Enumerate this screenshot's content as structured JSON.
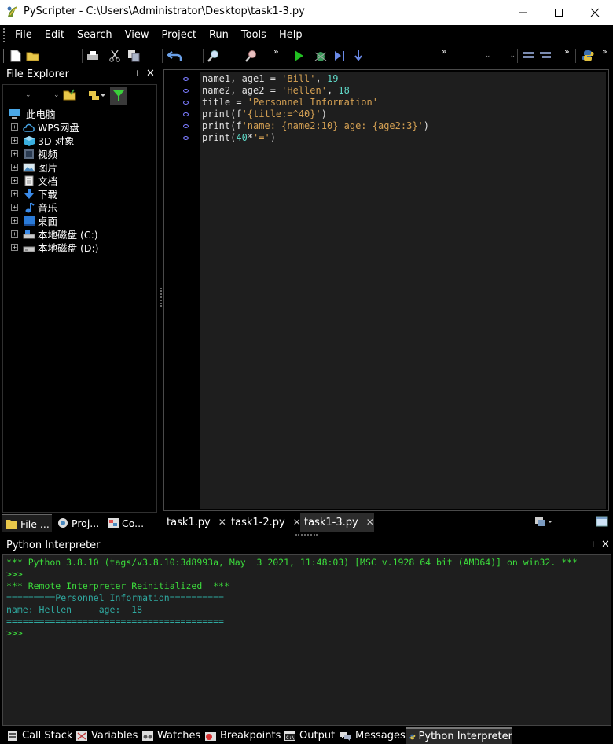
{
  "window": {
    "title": "PyScripter - C:\\Users\\Administrator\\Desktop\\task1-3.py"
  },
  "menu": [
    "File",
    "Edit",
    "Search",
    "View",
    "Project",
    "Run",
    "Tools",
    "Help"
  ],
  "file_explorer": {
    "title": "File Explorer",
    "root": "此电脑",
    "items": [
      "WPS网盘",
      "3D 对象",
      "视频",
      "图片",
      "文档",
      "下载",
      "音乐",
      "桌面",
      "本地磁盘 (C:)",
      "本地磁盘 (D:)"
    ],
    "tabs": [
      "File ...",
      "Proj...",
      "Co..."
    ]
  },
  "editor": {
    "lines": [
      [
        {
          "t": "name1, age1 = ",
          "c": ""
        },
        {
          "t": "'Bill'",
          "c": "s"
        },
        {
          "t": ", ",
          "c": ""
        },
        {
          "t": "19",
          "c": "n"
        }
      ],
      [
        {
          "t": "name2, age2 = ",
          "c": ""
        },
        {
          "t": "'Hellen'",
          "c": "s"
        },
        {
          "t": ", ",
          "c": ""
        },
        {
          "t": "18",
          "c": "n"
        }
      ],
      [
        {
          "t": "title = ",
          "c": ""
        },
        {
          "t": "'Personnel Information'",
          "c": "s"
        }
      ],
      [
        {
          "t": "print(f",
          "c": ""
        },
        {
          "t": "'{title:=^40}'",
          "c": "s"
        },
        {
          "t": ")",
          "c": ""
        }
      ],
      [
        {
          "t": "print(f",
          "c": ""
        },
        {
          "t": "'name: {name2:10} age: {age2:3}'",
          "c": "s"
        },
        {
          "t": ")",
          "c": ""
        }
      ],
      [
        {
          "t": "print(",
          "c": ""
        },
        {
          "t": "40",
          "c": "n"
        },
        {
          "t": "*",
          "c": ""
        },
        {
          "t": "'='",
          "c": "s"
        },
        {
          "t": ")",
          "c": ""
        }
      ]
    ],
    "tabs": [
      "task1.py",
      "task1-2.py",
      "task1-3.py"
    ],
    "active_tab": "task1-3.py"
  },
  "interpreter": {
    "title": "Python Interpreter",
    "lines": [
      {
        "t": "*** Python 3.8.10 (tags/v3.8.10:3d8993a, May  3 2021, 11:48:03) [MSC v.1928 64 bit (AMD64)] on win32. ***",
        "c": "g"
      },
      {
        "t": ">>>",
        "c": "g"
      },
      {
        "t": "*** Remote Interpreter Reinitialized  ***",
        "c": "g"
      },
      {
        "t": "=========Personnel Information==========",
        "c": "cy"
      },
      {
        "t": "name: Hellen     age:  18",
        "c": "cy"
      },
      {
        "t": "========================================",
        "c": "cy"
      },
      {
        "t": ">>>",
        "c": "g"
      }
    ]
  },
  "bottom_tabs": [
    "Call Stack",
    "Variables",
    "Watches",
    "Breakpoints",
    "Output",
    "Messages",
    "Python Interpreter"
  ],
  "bottom_active": "Python Interpreter"
}
